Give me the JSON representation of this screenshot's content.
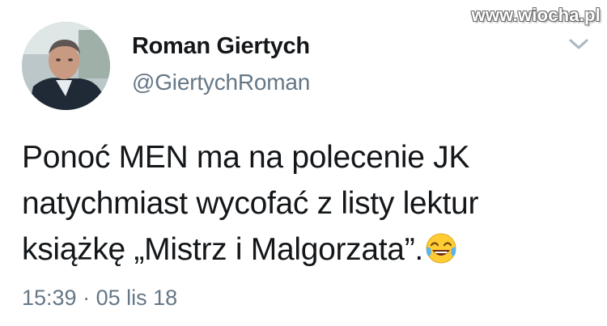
{
  "watermark": "www.wiocha.pl",
  "author": {
    "display_name": "Roman Giertych",
    "handle": "@GiertychRoman"
  },
  "tweet": {
    "text_line1": "Ponoć MEN ma na polecenie JK",
    "text_line2": "natychmiast wycofać z listy lektur",
    "text_line3": "książkę „Mistrz i Malgorzata”.",
    "emoji": "face-with-tears-of-joy",
    "time": "15:39",
    "separator": "·",
    "date": "05 lis 18"
  },
  "icons": {
    "menu": "chevron-down-icon",
    "avatar": "profile-photo"
  },
  "colors": {
    "text": "#14171a",
    "secondary": "#657786",
    "chevron": "#aab8c2",
    "background": "#ffffff"
  }
}
